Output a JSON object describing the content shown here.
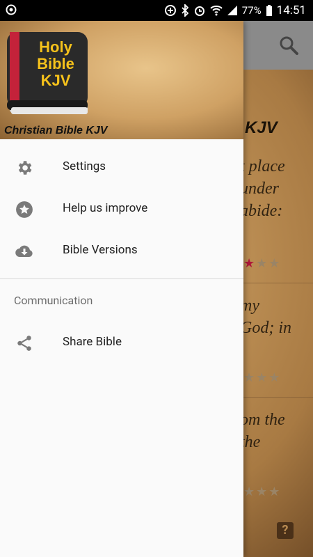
{
  "status_bar": {
    "battery": "77%",
    "time": "14:51"
  },
  "background": {
    "verse_title": "KJV",
    "lines": [
      "t place",
      " under",
      "abide:",
      "my",
      "God; in",
      "om the",
      " the"
    ]
  },
  "drawer": {
    "app_name": "Christian Bible KJV",
    "logo_text": [
      "Holy",
      "Bible",
      "KJV"
    ],
    "menu": [
      {
        "label": "Settings",
        "icon": "gear-icon"
      },
      {
        "label": "Help us improve",
        "icon": "star-icon"
      },
      {
        "label": "Bible Versions",
        "icon": "cloud-download-icon"
      }
    ],
    "section_title": "Communication",
    "section_items": [
      {
        "label": "Share Bible",
        "icon": "share-icon"
      }
    ]
  }
}
